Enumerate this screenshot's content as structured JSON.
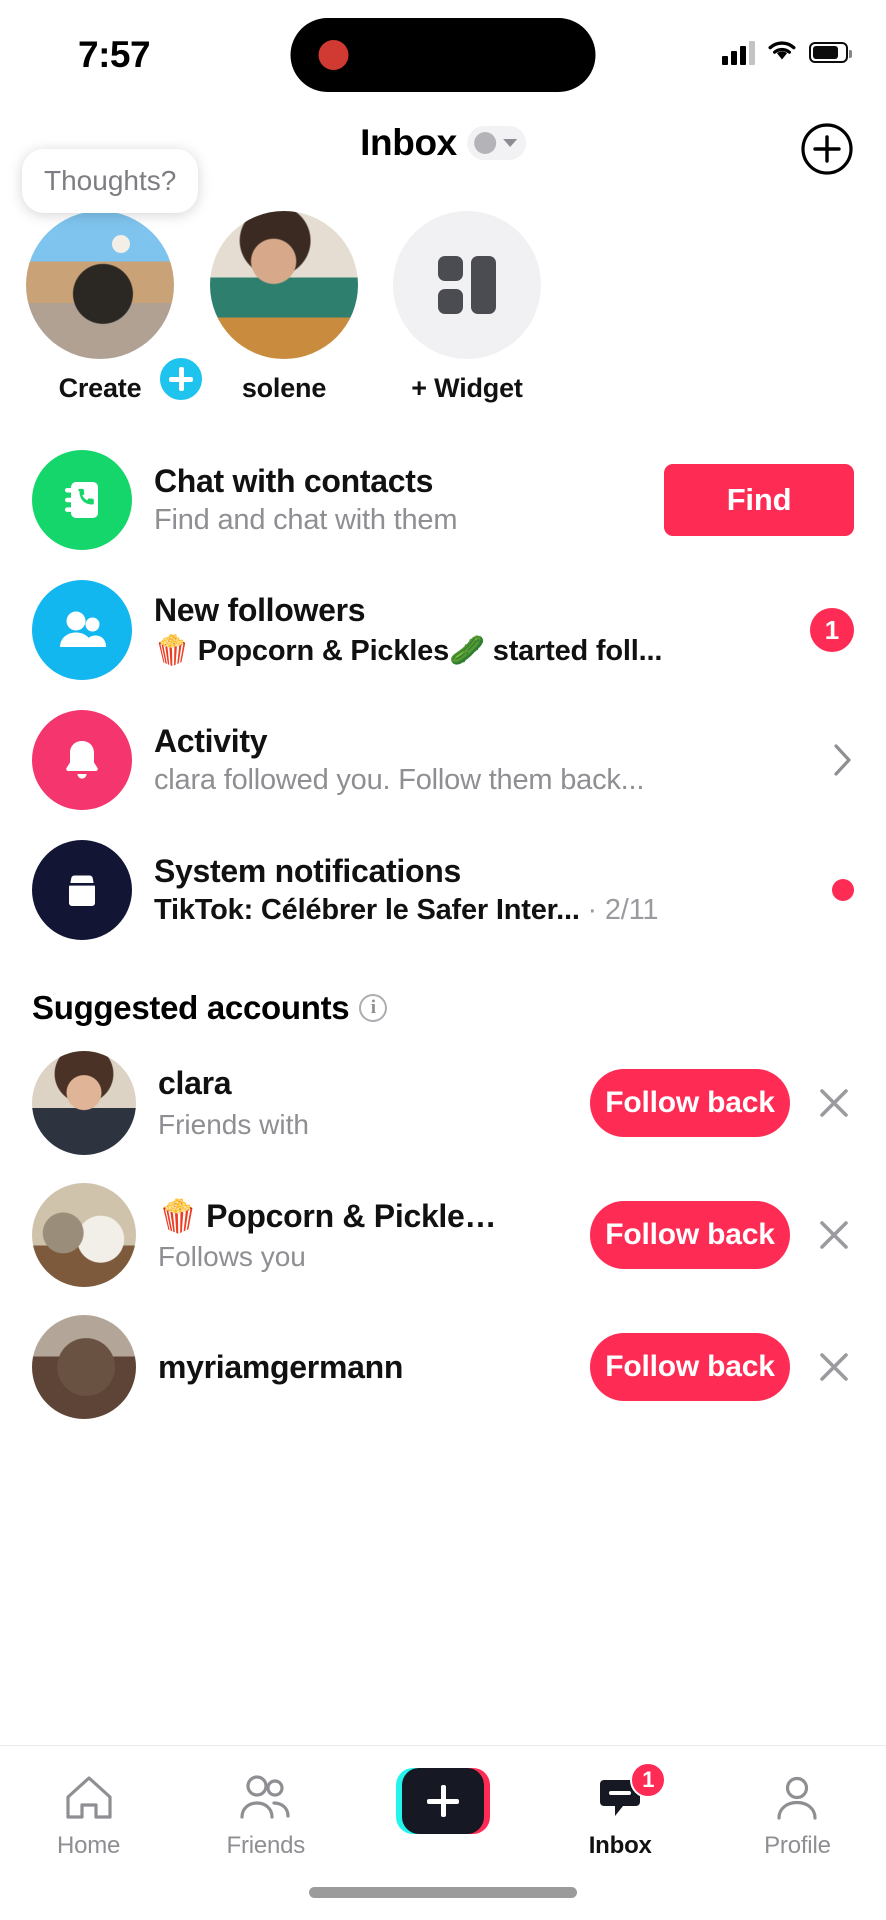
{
  "status_bar": {
    "time": "7:57",
    "signal_icon": "cellular-signal-icon",
    "wifi_icon": "wifi-icon",
    "battery_icon": "battery-icon",
    "recording_indicator": "recording-dot"
  },
  "header": {
    "title": "Inbox",
    "account_switcher_icon": "account-avatar-dot",
    "dropdown_icon": "chevron-down-icon",
    "add_icon": "plus-circle-icon"
  },
  "stories": {
    "thoughts_bubble": "Thoughts?",
    "items": [
      {
        "label": "Create",
        "avatar": "cat-photo",
        "badge_icon": "plus-badge-icon"
      },
      {
        "label": "solene",
        "avatar": "solene-selfie-photo"
      },
      {
        "label": "+ Widget",
        "avatar": "widget-grid-icon"
      }
    ]
  },
  "notifications": [
    {
      "icon": "contacts-phone-icon",
      "icon_color": "#15D66B",
      "title": "Chat with contacts",
      "subtitle": "Find and chat with them",
      "action_label": "Find"
    },
    {
      "icon": "two-people-icon",
      "icon_color": "#12B7EF",
      "title": "New followers",
      "subtitle": "🍿 Popcorn & Pickles🥒 started foll...",
      "badge": "1"
    },
    {
      "icon": "bell-icon",
      "icon_color": "#F5356E",
      "title": "Activity",
      "subtitle": "clara followed you. Follow them back...",
      "chevron": "chevron-right-icon"
    },
    {
      "icon": "mailbox-icon",
      "icon_color": "#121634",
      "title": "System notifications",
      "subtitle": "TikTok: Célébrer le Safer Inter...",
      "timestamp": "· 2/11",
      "unread_dot": true
    }
  ],
  "suggested": {
    "heading": "Suggested accounts",
    "info_icon": "info-circle-icon",
    "accounts": [
      {
        "name": "clara",
        "subtitle": "Friends with",
        "has_mini_avatar": true,
        "avatar": "clara-photo",
        "action_label": "Follow back",
        "dismiss_icon": "close-icon"
      },
      {
        "name": "🍿 Popcorn & Pickle…",
        "subtitle": "Follows you",
        "has_mini_avatar": false,
        "avatar": "two-cats-photo",
        "action_label": "Follow back",
        "dismiss_icon": "close-icon"
      },
      {
        "name": "myriamgermann",
        "subtitle": "",
        "has_mini_avatar": false,
        "avatar": "myriam-photo",
        "action_label": "Follow back",
        "dismiss_icon": "close-icon"
      }
    ]
  },
  "tabbar": {
    "items": [
      {
        "label": "Home",
        "icon": "home-icon",
        "active": false
      },
      {
        "label": "Friends",
        "icon": "friends-icon",
        "active": false
      },
      {
        "label": "",
        "icon": "create-plus-icon",
        "active": false
      },
      {
        "label": "Inbox",
        "icon": "inbox-message-icon",
        "active": true,
        "badge": "1"
      },
      {
        "label": "Profile",
        "icon": "profile-person-icon",
        "active": false
      }
    ]
  },
  "colors": {
    "accent_red": "#FE2C55",
    "cyan": "#25F4EE",
    "green": "#15D66B",
    "blue": "#12B7EF",
    "pink": "#F5356E",
    "navy": "#121634"
  }
}
